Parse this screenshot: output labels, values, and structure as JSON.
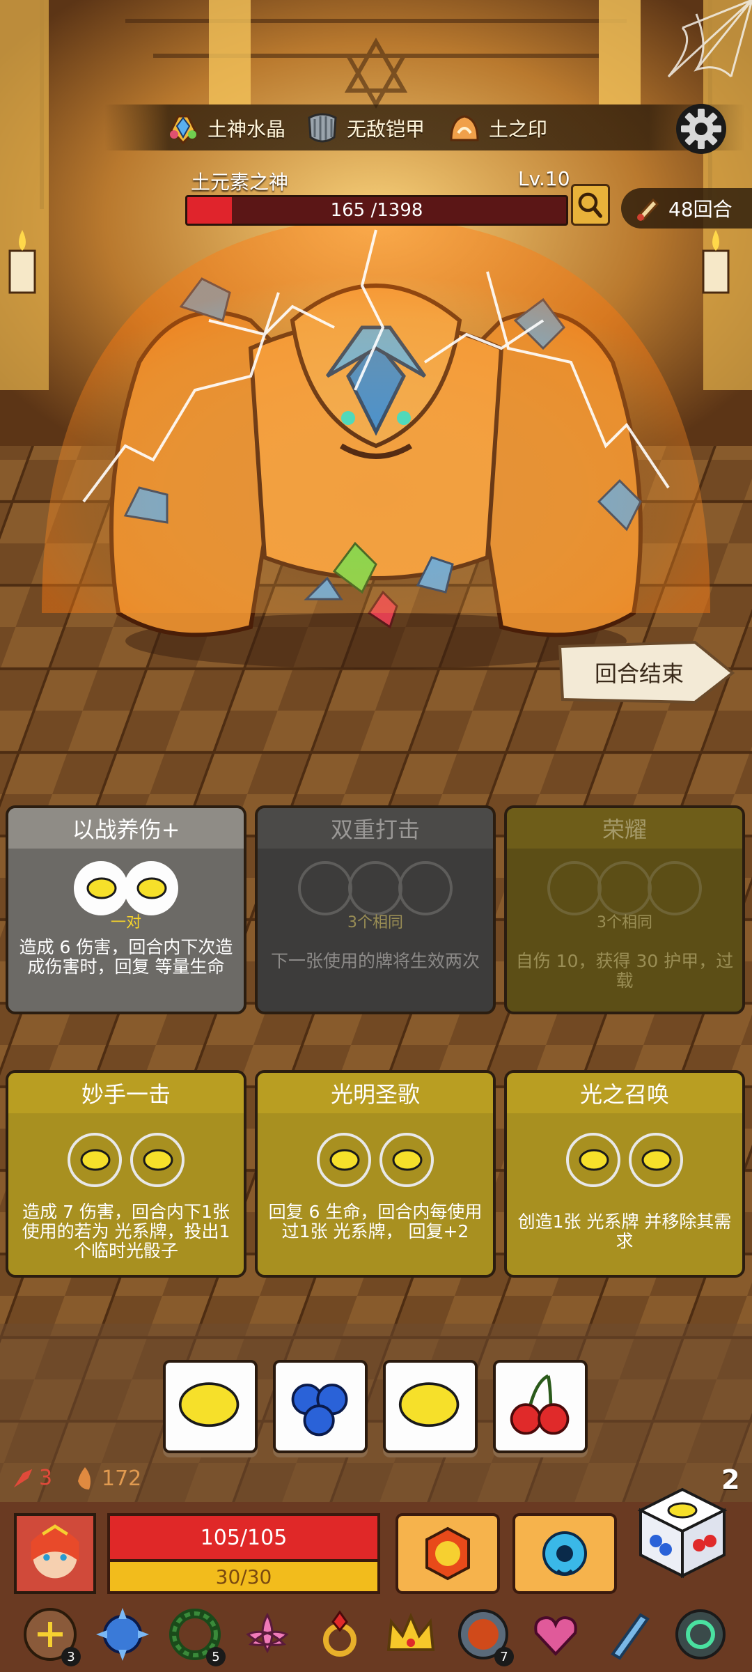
{
  "relics_top": [
    {
      "label": "土神水晶",
      "icon": "crystal-icon"
    },
    {
      "label": "无敌铠甲",
      "icon": "armor-icon"
    },
    {
      "label": "土之印",
      "icon": "earth-seal-icon"
    }
  ],
  "boss": {
    "name": "土元素之神",
    "level": "Lv.10",
    "hp_text": "165 /1398",
    "hp_current": 165,
    "hp_max": 1398
  },
  "round": {
    "label": "48回合"
  },
  "end_turn": {
    "label": "回合结束"
  },
  "cards_row1": [
    {
      "title": "以战养伤+",
      "req": "一对",
      "desc": "造成 6 伤害，回合内下次造成伤害时，回复 等量生命",
      "style": "gray"
    },
    {
      "title": "双重打击",
      "req": "3个相同",
      "desc": "下一张使用的牌将生效两次",
      "style": "dark"
    },
    {
      "title": "荣耀",
      "req": "3个相同",
      "desc": "自伤 10，获得 30 护甲，过载",
      "style": "olive"
    }
  ],
  "cards_row2": [
    {
      "title": "妙手一击",
      "desc": "造成 7 伤害，回合内下1张使用的若为 光系牌，投出1个临时光骰子"
    },
    {
      "title": "光明圣歌",
      "desc": "回复 6 生命，回合内每使用过1张 光系牌， 回复+2"
    },
    {
      "title": "光之召唤",
      "desc": "创造1张 光系牌 并移除其需求"
    }
  ],
  "dice": [
    {
      "face": "lemon"
    },
    {
      "face": "blueberry"
    },
    {
      "face": "lemon"
    },
    {
      "face": "cherry"
    }
  ],
  "stats": {
    "attack": "3",
    "fire": "172",
    "dice_count": "2"
  },
  "player": {
    "hp_text": "105/105",
    "mp_text": "30/30"
  },
  "relic_badges": {
    "r1": "3",
    "r3": "5",
    "r9": "7"
  },
  "colors": {
    "hp_red": "#e0242c",
    "mp_yellow": "#f2bc1c",
    "card_gold": "#a89020"
  }
}
